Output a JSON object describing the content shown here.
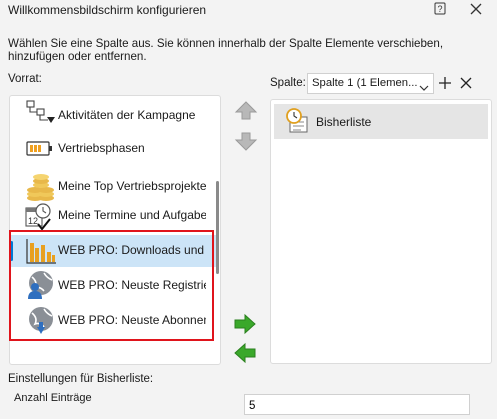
{
  "window": {
    "title": "Willkommensbildschirm konfigurieren"
  },
  "description": "Wählen Sie eine Spalte aus. Sie können innerhalb der Spalte Elemente verschieben, hinzufügen oder entfernen.",
  "vorrat": {
    "label": "Vorrat:",
    "items": [
      {
        "label": "Aktivitäten der Kampagne",
        "icon": "workflow-icon",
        "selected": false
      },
      {
        "label": "Vertriebsphasen",
        "icon": "battery-icon",
        "selected": false
      },
      {
        "label": "Meine Top Vertriebsprojekte",
        "icon": "coins-icon",
        "selected": false
      },
      {
        "label": "Meine Termine und Aufgaben",
        "icon": "calendar-clock-icon",
        "selected": false
      },
      {
        "label": "WEB PRO: Downloads und",
        "icon": "bar-chart-icon",
        "selected": true
      },
      {
        "label": "WEB PRO: Neuste Registrierungen",
        "icon": "globe-user-icon",
        "selected": false
      },
      {
        "label": "WEB PRO: Neuste Abonnenten",
        "icon": "globe-download-icon",
        "selected": false
      }
    ]
  },
  "spalte": {
    "label": "Spalte:",
    "selected_column": "Spalte 1 (1 Elemen...",
    "items": [
      {
        "label": "Bisherliste",
        "icon": "clock-list-icon"
      }
    ]
  },
  "settings": {
    "label": "Einstellungen für Bisherliste:",
    "anzahl_label": "Anzahl Einträge",
    "anzahl_value": "5"
  },
  "colors": {
    "selection": "#cce4f7",
    "highlight_border": "#e0141c",
    "accent": "#0078d4",
    "arrow_green": "#3aa82a"
  }
}
